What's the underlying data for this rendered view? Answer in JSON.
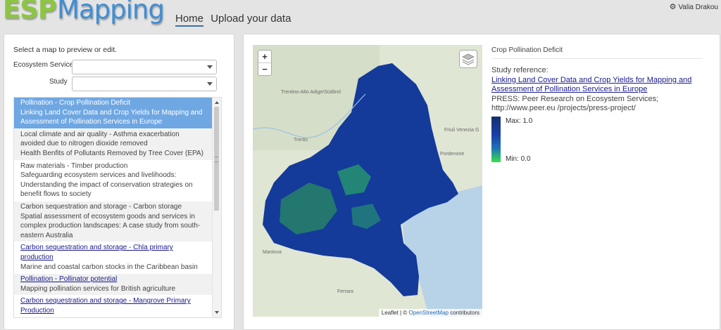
{
  "header": {
    "logo_esp": "ESP",
    "logo_mapping": "Mapping",
    "nav": [
      "Home",
      "Upload your data"
    ],
    "user": "Valia Drakou"
  },
  "left": {
    "prompt": "Select a map to preview or edit.",
    "ecosystem_label": "Ecosystem Service",
    "ecosystem_value": "",
    "study_label": "Study",
    "study_value": "",
    "items": [
      {
        "title": "Pollination - Crop Pollination Deficit",
        "subtitle": "Linking Land Cover Data and Crop Yields for Mapping and Assessment of Pollination Services in Europe",
        "selected": true,
        "link": false
      },
      {
        "title": "Local climate and air quality - Asthma exacerbation avoided due to nitrogen dioxide removed",
        "subtitle": "Health Benfits of Pollutants Removed by Tree Cover (EPA)",
        "selected": false,
        "link": false
      },
      {
        "title": "Raw materials - Timber production",
        "subtitle": "Safeguarding ecosystem services and livelihoods: Understanding the impact of conservation strategies on benefit flows to society",
        "selected": false,
        "link": false
      },
      {
        "title": "Carbon sequestration and storage - Carbon storage",
        "subtitle": "Spatial assessment of ecosystem goods and services in complex production landscapes: A case study from south-eastern Australia",
        "selected": false,
        "link": false
      },
      {
        "title": "Carbon sequestration and storage - Chla primary production",
        "subtitle": "Marine and coastal carbon stocks in the Caribbean basin",
        "selected": false,
        "link": true
      },
      {
        "title": "Pollination - Pollinator potential",
        "subtitle": "Mapping pollination services for British agriculture",
        "selected": false,
        "link": true
      },
      {
        "title": "Carbon sequestration and storage - Mangrove Primary Production",
        "subtitle": "",
        "selected": false,
        "link": true
      }
    ]
  },
  "map": {
    "zoom_in": "+",
    "zoom_out": "−",
    "attribution_prefix": "Leaflet | © ",
    "attribution_osm": "OpenStreetMap",
    "attribution_suffix": " contributors",
    "labels": [
      "Trentino-Alto Adige/Südtirol",
      "Trento",
      "Friuli Venezia G",
      "Pordenone",
      "Mantova",
      "Ferrara"
    ],
    "colors": {
      "water": "#b8d3e8",
      "land": "#dfe6d4",
      "data_high": "#143a9a",
      "data_low": "#34e24a"
    }
  },
  "info": {
    "title": "Crop Pollination Deficit",
    "study_reference_label": "Study reference:",
    "study_link": "Linking Land Cover Data and Crop Yields for Mapping and Assessment of Pollination Services in Europe",
    "press": "PRESS: Peer Research on Ecosystem Services; http://www.peer.eu /projects/press-project/",
    "legend_max": "Max: 1.0",
    "legend_min": "Min: 0.0"
  }
}
